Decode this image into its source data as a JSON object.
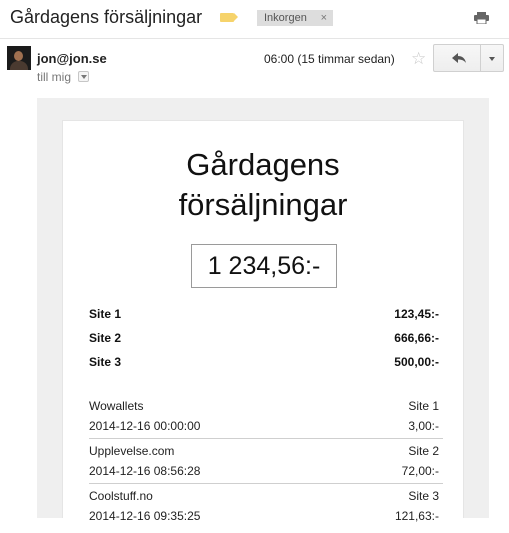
{
  "email": {
    "subject": "Gårdagens försäljningar",
    "label_chip": "Inkorgen",
    "label_chip_close": "×",
    "sender": "jon@jon.se",
    "recipient_line": "till mig",
    "time": "06:00 (15 timmar sedan)"
  },
  "icons": {
    "label": "label-tag-icon",
    "print": "print-icon",
    "star": "star-icon",
    "reply": "reply-icon",
    "more": "chevron-down-icon"
  },
  "colors": {
    "label": "#f6d36b",
    "chip_bg": "#dddddd",
    "body_bg": "#efefef"
  },
  "report": {
    "title_line1": "Gårdagens",
    "title_line2": "försäljningar",
    "total": "1 234,56:-",
    "sites": [
      {
        "name": "Site 1",
        "amount": "123,45:-"
      },
      {
        "name": "Site 2",
        "amount": "666,66:-"
      },
      {
        "name": "Site 3",
        "amount": "500,00:-"
      }
    ],
    "transactions": [
      {
        "shop": "Wowallets",
        "site": "Site 1",
        "datetime": "2014-12-16 00:00:00",
        "amount": "3,00:-"
      },
      {
        "shop": "Upplevelse.com",
        "site": "Site 2",
        "datetime": "2014-12-16 08:56:28",
        "amount": "72,00:-"
      },
      {
        "shop": "Coolstuff.no",
        "site": "Site 3",
        "datetime": "2014-12-16 09:35:25",
        "amount": "121,63:-"
      }
    ]
  }
}
